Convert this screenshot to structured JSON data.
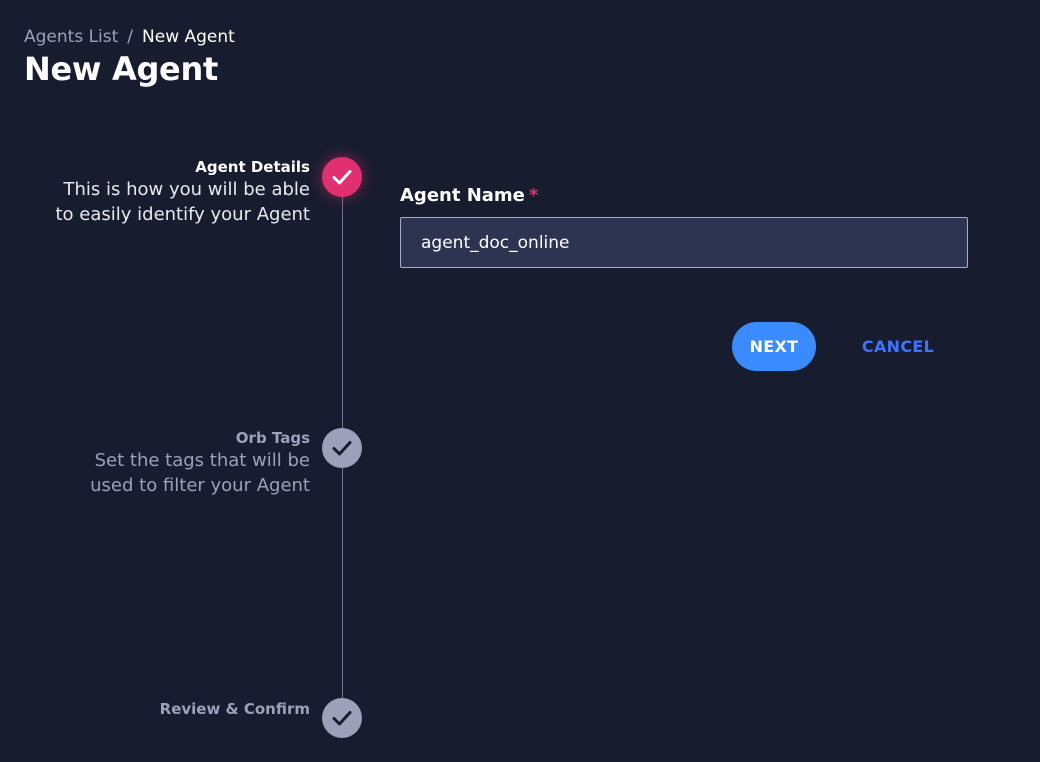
{
  "breadcrumb": {
    "parent": "Agents List",
    "separator": "/",
    "current": "New Agent"
  },
  "page": {
    "title": "New Agent"
  },
  "stepper": {
    "steps": [
      {
        "title": "Agent Details",
        "description_line1": "This is how you will be able",
        "description_line2": "to easily identify your Agent",
        "state": "active",
        "icon": "check-icon"
      },
      {
        "title": "Orb Tags",
        "description_line1": "Set the tags that will be",
        "description_line2": "used to filter your Agent",
        "state": "inactive",
        "icon": "check-icon"
      },
      {
        "title": "Review & Confirm",
        "state": "inactive",
        "icon": "check-icon"
      }
    ]
  },
  "form": {
    "agent_name_label": "Agent Name",
    "required_marker": "*",
    "agent_name_value": "agent_doc_online"
  },
  "actions": {
    "next_label": "NEXT",
    "cancel_label": "CANCEL"
  },
  "colors": {
    "background": "#181c2f",
    "active_step": "#e0306f",
    "inactive_step": "#9aa1b9",
    "primary_button": "#3a8bff",
    "cancel_text": "#3a74ff",
    "input_background": "#2c3452"
  }
}
